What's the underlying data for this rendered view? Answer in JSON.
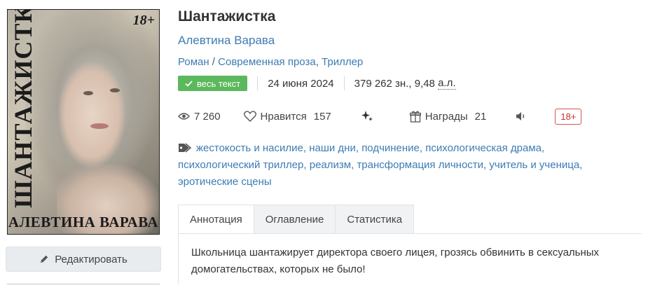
{
  "cover": {
    "title": "ШАНТАЖИСТКА",
    "age": "18+",
    "author": "АЛЕВТИНА ВАРАВА"
  },
  "edit_button": {
    "label": "Редактировать",
    "icon": "pencil-icon"
  },
  "book": {
    "title": "Шантажистка",
    "author": "Алевтина Варава",
    "genre_main": "Роман",
    "genre_sub": "Современная проза",
    "genre_extra": "Триллер",
    "status_badge": "весь текст",
    "date": "24 июня 2024",
    "chars": "379 262 зн., 9,48",
    "chars_unit": "а.л."
  },
  "stats": {
    "views": "7 260",
    "likes_label": "Нравится",
    "likes": "157",
    "awards_label": "Награды",
    "awards": "21",
    "age_rating": "18+"
  },
  "tags": [
    "жестокость и насилие",
    "наши дни",
    "подчинение",
    "психологическая драма",
    "психологический триллер",
    "реализм",
    "трансформация личности",
    "учитель и ученица",
    "эротические сцены"
  ],
  "tabs": [
    "Аннотация",
    "Оглавление",
    "Статистика"
  ],
  "annotation": "Школьница шантажирует директора своего лицея, грозясь обвинить в сексуальных домогательствах, которых не было!",
  "colors": {
    "link": "#3d7cb3",
    "badge_green": "#5cb85c",
    "age_red": "#d9534f"
  }
}
